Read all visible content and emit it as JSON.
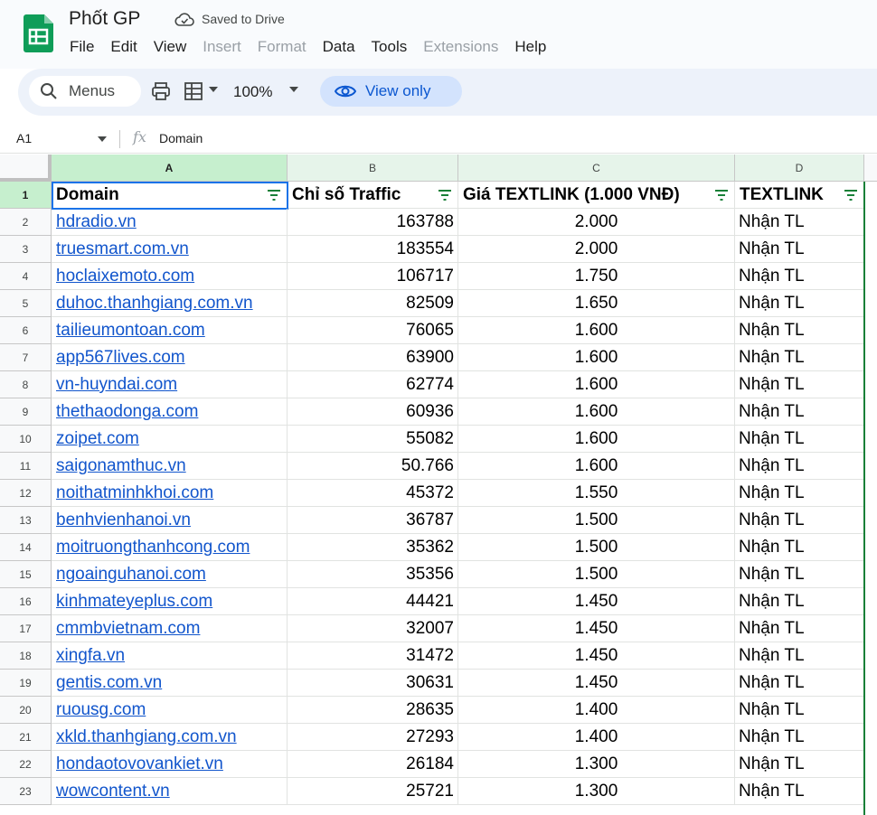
{
  "app": {
    "title": "Phốt GP",
    "saved_status": "Saved to Drive",
    "brand_color": "#0f9d58"
  },
  "menu": [
    {
      "label": "File",
      "disabled": false
    },
    {
      "label": "Edit",
      "disabled": false
    },
    {
      "label": "View",
      "disabled": false
    },
    {
      "label": "Insert",
      "disabled": true
    },
    {
      "label": "Format",
      "disabled": true
    },
    {
      "label": "Data",
      "disabled": false
    },
    {
      "label": "Tools",
      "disabled": false
    },
    {
      "label": "Extensions",
      "disabled": true
    },
    {
      "label": "Help",
      "disabled": false
    }
  ],
  "toolbar": {
    "search_label": "Menus",
    "zoom": "100%",
    "view_only_label": "View only"
  },
  "formula_bar": {
    "cell_ref": "A1",
    "content": "Domain"
  },
  "columns": [
    "A",
    "B",
    "C",
    "D"
  ],
  "sheet": {
    "headers": [
      "Domain",
      "Chỉ số Traffic",
      "Giá TEXTLINK (1.000 VNĐ)",
      "TEXTLINK"
    ],
    "rows": [
      {
        "n": "2",
        "domain": "hdradio.vn",
        "traffic": "163788",
        "price": "2.000",
        "textlink": "Nhận TL"
      },
      {
        "n": "3",
        "domain": "truesmart.com.vn",
        "traffic": "183554",
        "price": "2.000",
        "textlink": "Nhận TL"
      },
      {
        "n": "4",
        "domain": "hoclaixemoto.com",
        "traffic": "106717",
        "price": "1.750",
        "textlink": "Nhận TL"
      },
      {
        "n": "5",
        "domain": "duhoc.thanhgiang.com.vn",
        "traffic": "82509",
        "price": "1.650",
        "textlink": "Nhận TL"
      },
      {
        "n": "6",
        "domain": "tailieumontoan.com",
        "traffic": "76065",
        "price": "1.600",
        "textlink": "Nhận TL"
      },
      {
        "n": "7",
        "domain": "app567lives.com",
        "traffic": "63900",
        "price": "1.600",
        "textlink": "Nhận TL"
      },
      {
        "n": "8",
        "domain": "vn-huyndai.com",
        "traffic": "62774",
        "price": "1.600",
        "textlink": "Nhận TL"
      },
      {
        "n": "9",
        "domain": "thethaodonga.com",
        "traffic": "60936",
        "price": "1.600",
        "textlink": "Nhận TL"
      },
      {
        "n": "10",
        "domain": "zoipet.com",
        "traffic": "55082",
        "price": "1.600",
        "textlink": "Nhận TL"
      },
      {
        "n": "11",
        "domain": "saigonamthuc.vn",
        "traffic": "50.766",
        "price": "1.600",
        "textlink": "Nhận TL"
      },
      {
        "n": "12",
        "domain": "noithatminhkhoi.com",
        "traffic": "45372",
        "price": "1.550",
        "textlink": "Nhận TL"
      },
      {
        "n": "13",
        "domain": "benhvienhanoi.vn",
        "traffic": "36787",
        "price": "1.500",
        "textlink": "Nhận TL"
      },
      {
        "n": "14",
        "domain": "moitruongthanhcong.com",
        "traffic": "35362",
        "price": "1.500",
        "textlink": "Nhận TL"
      },
      {
        "n": "15",
        "domain": "ngoainguhanoi.com",
        "traffic": "35356",
        "price": "1.500",
        "textlink": "Nhận TL"
      },
      {
        "n": "16",
        "domain": "kinhmateyeplus.com",
        "traffic": "44421",
        "price": "1.450",
        "textlink": "Nhận TL"
      },
      {
        "n": "17",
        "domain": "cmmbvietnam.com",
        "traffic": "32007",
        "price": "1.450",
        "textlink": "Nhận TL"
      },
      {
        "n": "18",
        "domain": "xingfa.vn",
        "traffic": "31472",
        "price": "1.450",
        "textlink": "Nhận TL"
      },
      {
        "n": "19",
        "domain": "gentis.com.vn",
        "traffic": "30631",
        "price": "1.450",
        "textlink": "Nhận TL"
      },
      {
        "n": "20",
        "domain": "ruousg.com",
        "traffic": "28635",
        "price": "1.400",
        "textlink": "Nhận TL"
      },
      {
        "n": "21",
        "domain": "xkld.thanhgiang.com.vn",
        "traffic": "27293",
        "price": "1.400",
        "textlink": "Nhận TL"
      },
      {
        "n": "22",
        "domain": "hondaotovovankiet.vn",
        "traffic": "26184",
        "price": "1.300",
        "textlink": "Nhận TL"
      },
      {
        "n": "23",
        "domain": "wowcontent.vn",
        "traffic": "25721",
        "price": "1.300",
        "textlink": "Nhận TL"
      }
    ]
  }
}
